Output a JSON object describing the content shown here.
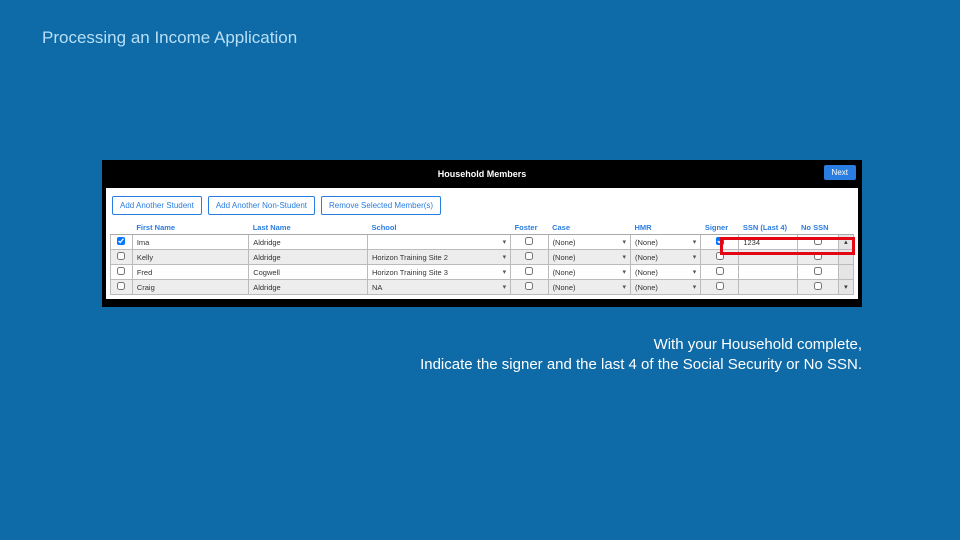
{
  "slide": {
    "title": "Processing an Income Application"
  },
  "panel": {
    "title": "Household Members",
    "next": "Next",
    "buttons": {
      "add_student": "Add Another Student",
      "add_non_student": "Add Another Non-Student",
      "remove": "Remove Selected Member(s)"
    }
  },
  "columns": {
    "first_name": "First Name",
    "last_name": "Last Name",
    "school": "School",
    "foster": "Foster",
    "case": "Case",
    "hmr": "HMR",
    "signer": "Signer",
    "ssn": "SSN (Last 4)",
    "no_ssn": "No SSN"
  },
  "rows": [
    {
      "sel": true,
      "first": "Ima",
      "last": "Aldridge",
      "school": "",
      "foster": false,
      "case": "(None)",
      "hmr": "(None)",
      "signer": true,
      "ssn": "1234",
      "no_ssn": false
    },
    {
      "sel": false,
      "first": "Kelly",
      "last": "Aldridge",
      "school": "Horizon Training Site 2",
      "foster": false,
      "case": "(None)",
      "hmr": "(None)",
      "signer": false,
      "ssn": "",
      "no_ssn": false
    },
    {
      "sel": false,
      "first": "Fred",
      "last": "Cogwell",
      "school": "Horizon Training Site 3",
      "foster": false,
      "case": "(None)",
      "hmr": "(None)",
      "signer": false,
      "ssn": "",
      "no_ssn": false
    },
    {
      "sel": false,
      "first": "Craig",
      "last": "Aldridge",
      "school": "NA",
      "foster": false,
      "case": "(None)",
      "hmr": "(None)",
      "signer": false,
      "ssn": "",
      "no_ssn": false
    }
  ],
  "caption": {
    "line1": "With your Household complete,",
    "line2": "Indicate the signer and the last 4 of the Social Security or No SSN."
  }
}
